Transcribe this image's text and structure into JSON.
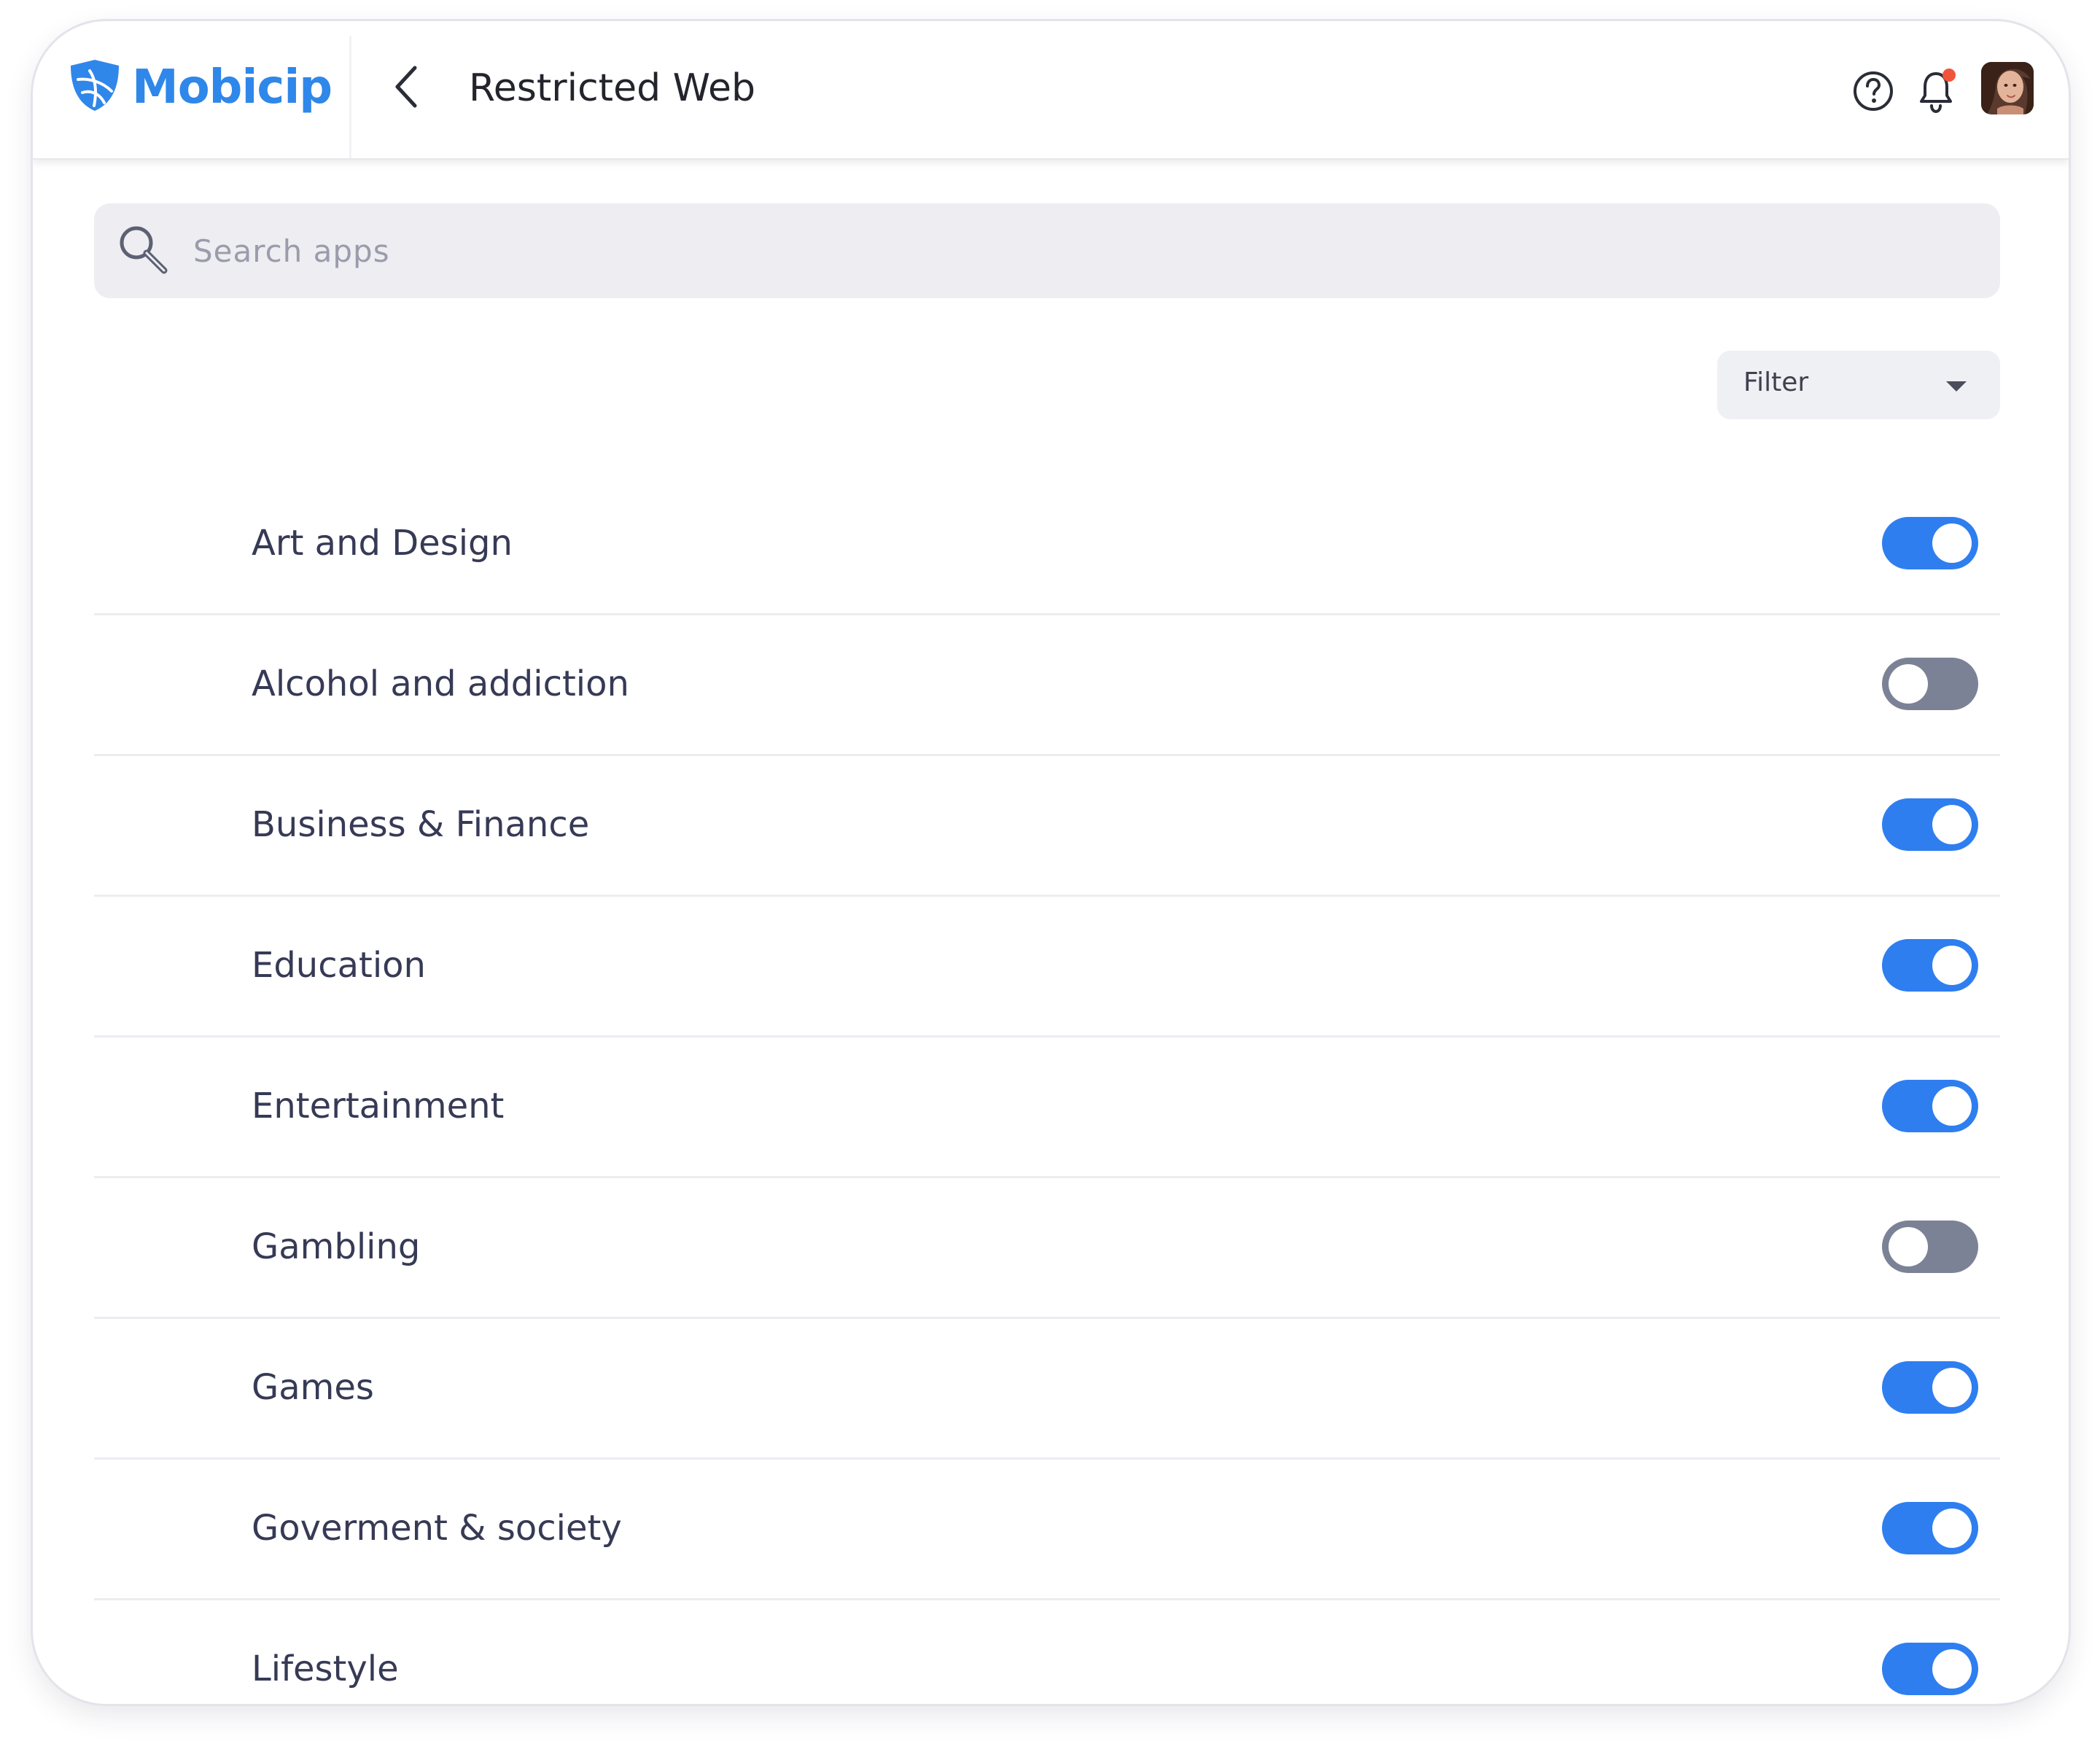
{
  "header": {
    "logo_text": "Mobicip",
    "title": "Restricted Web",
    "help_icon": "question-circle-icon",
    "bell_icon": "bell-icon",
    "notification_dot": true,
    "back_icon": "chevron-left-icon"
  },
  "search": {
    "placeholder": "Search apps",
    "value": ""
  },
  "filter": {
    "label": "Filter"
  },
  "colors": {
    "brand": "#2f87ea",
    "toggle_on": "#2f7ef0",
    "toggle_off": "#7c8296",
    "notification": "#f0553c"
  },
  "categories": [
    {
      "label": "Art and Design",
      "enabled": true
    },
    {
      "label": "Alcohol and addiction",
      "enabled": false
    },
    {
      "label": "Business & Finance",
      "enabled": true
    },
    {
      "label": "Education",
      "enabled": true
    },
    {
      "label": "Entertainment",
      "enabled": true
    },
    {
      "label": "Gambling",
      "enabled": false
    },
    {
      "label": "Games",
      "enabled": true
    },
    {
      "label": "Goverment & society",
      "enabled": true
    },
    {
      "label": "Lifestyle",
      "enabled": true
    }
  ]
}
